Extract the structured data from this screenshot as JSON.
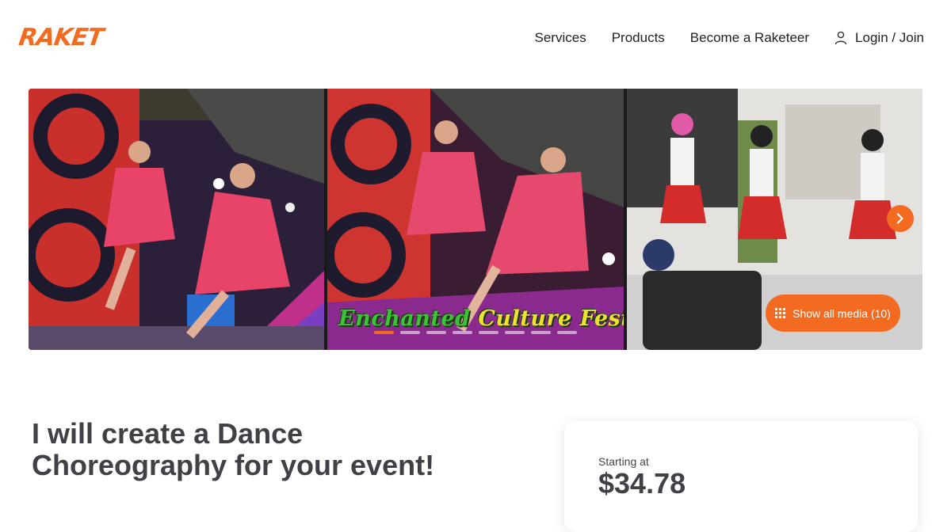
{
  "brand": {
    "logo_text": "RAKET",
    "accent_color": "#f26b21"
  },
  "nav": {
    "items": [
      {
        "label": "Services"
      },
      {
        "label": "Products"
      },
      {
        "label": "Become a Raketeer"
      }
    ],
    "login_label": "Login / Join",
    "login_icon": "user-icon"
  },
  "gallery": {
    "photo_overlay": {
      "part1": "Enchanted ",
      "part2": "Culture Fest"
    },
    "slide_count": 8,
    "active_slide": 1,
    "show_all_label": "Show all media (10)",
    "show_all_icon": "grid-icon",
    "next_icon": "chevron-right-icon"
  },
  "gig": {
    "title": "I will create a Dance Choreography for your event!"
  },
  "pricing": {
    "starting_label": "Starting at",
    "price": "$34.78"
  }
}
